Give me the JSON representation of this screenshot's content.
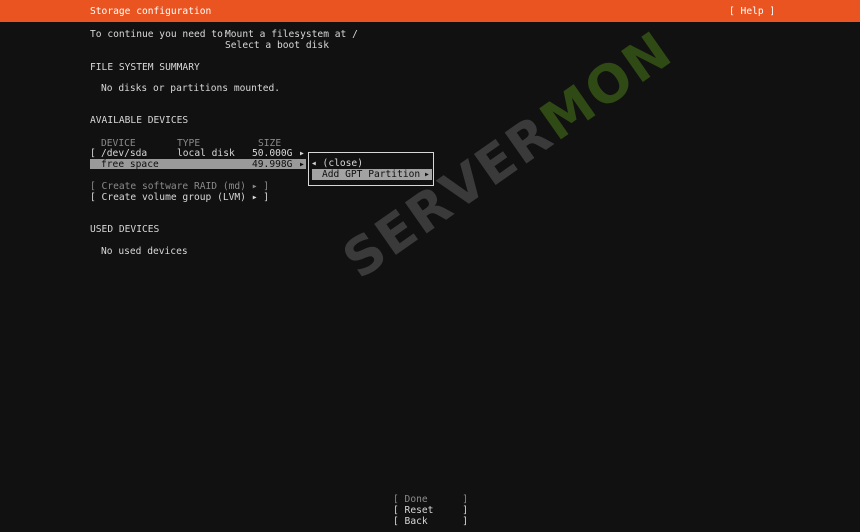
{
  "header": {
    "title": "Storage configuration",
    "help": "[ Help ]"
  },
  "intro": {
    "prefix": "To continue you need to:",
    "line1": "Mount a filesystem at /",
    "line2": "Select a boot disk"
  },
  "fs_summary": {
    "heading": "FILE SYSTEM SUMMARY",
    "empty": "No disks or partitions mounted."
  },
  "available": {
    "heading": "AVAILABLE DEVICES",
    "columns": [
      "DEVICE",
      "TYPE",
      "SIZE"
    ],
    "disk": {
      "bracket": "[",
      "device": "/dev/sda",
      "type": "local disk",
      "size": "50.000G",
      "arrow": "▸"
    },
    "free": {
      "device": "free space",
      "size": "49.998G",
      "arrow": "▸"
    },
    "raid": "[ Create software RAID (md) ▸ ]",
    "lvm": "[ Create volume group (LVM) ▸ ]"
  },
  "popup": {
    "close": "◂ (close)",
    "add_gpt": "Add GPT Partition",
    "add_gpt_arrow": "▸"
  },
  "used": {
    "heading": "USED DEVICES",
    "empty": "No used devices"
  },
  "footer": {
    "done": "[ Done      ]",
    "reset": "[ Reset     ]",
    "back": "[ Back      ]"
  },
  "watermark": {
    "part1": "SERVER",
    "part2": "MON"
  }
}
